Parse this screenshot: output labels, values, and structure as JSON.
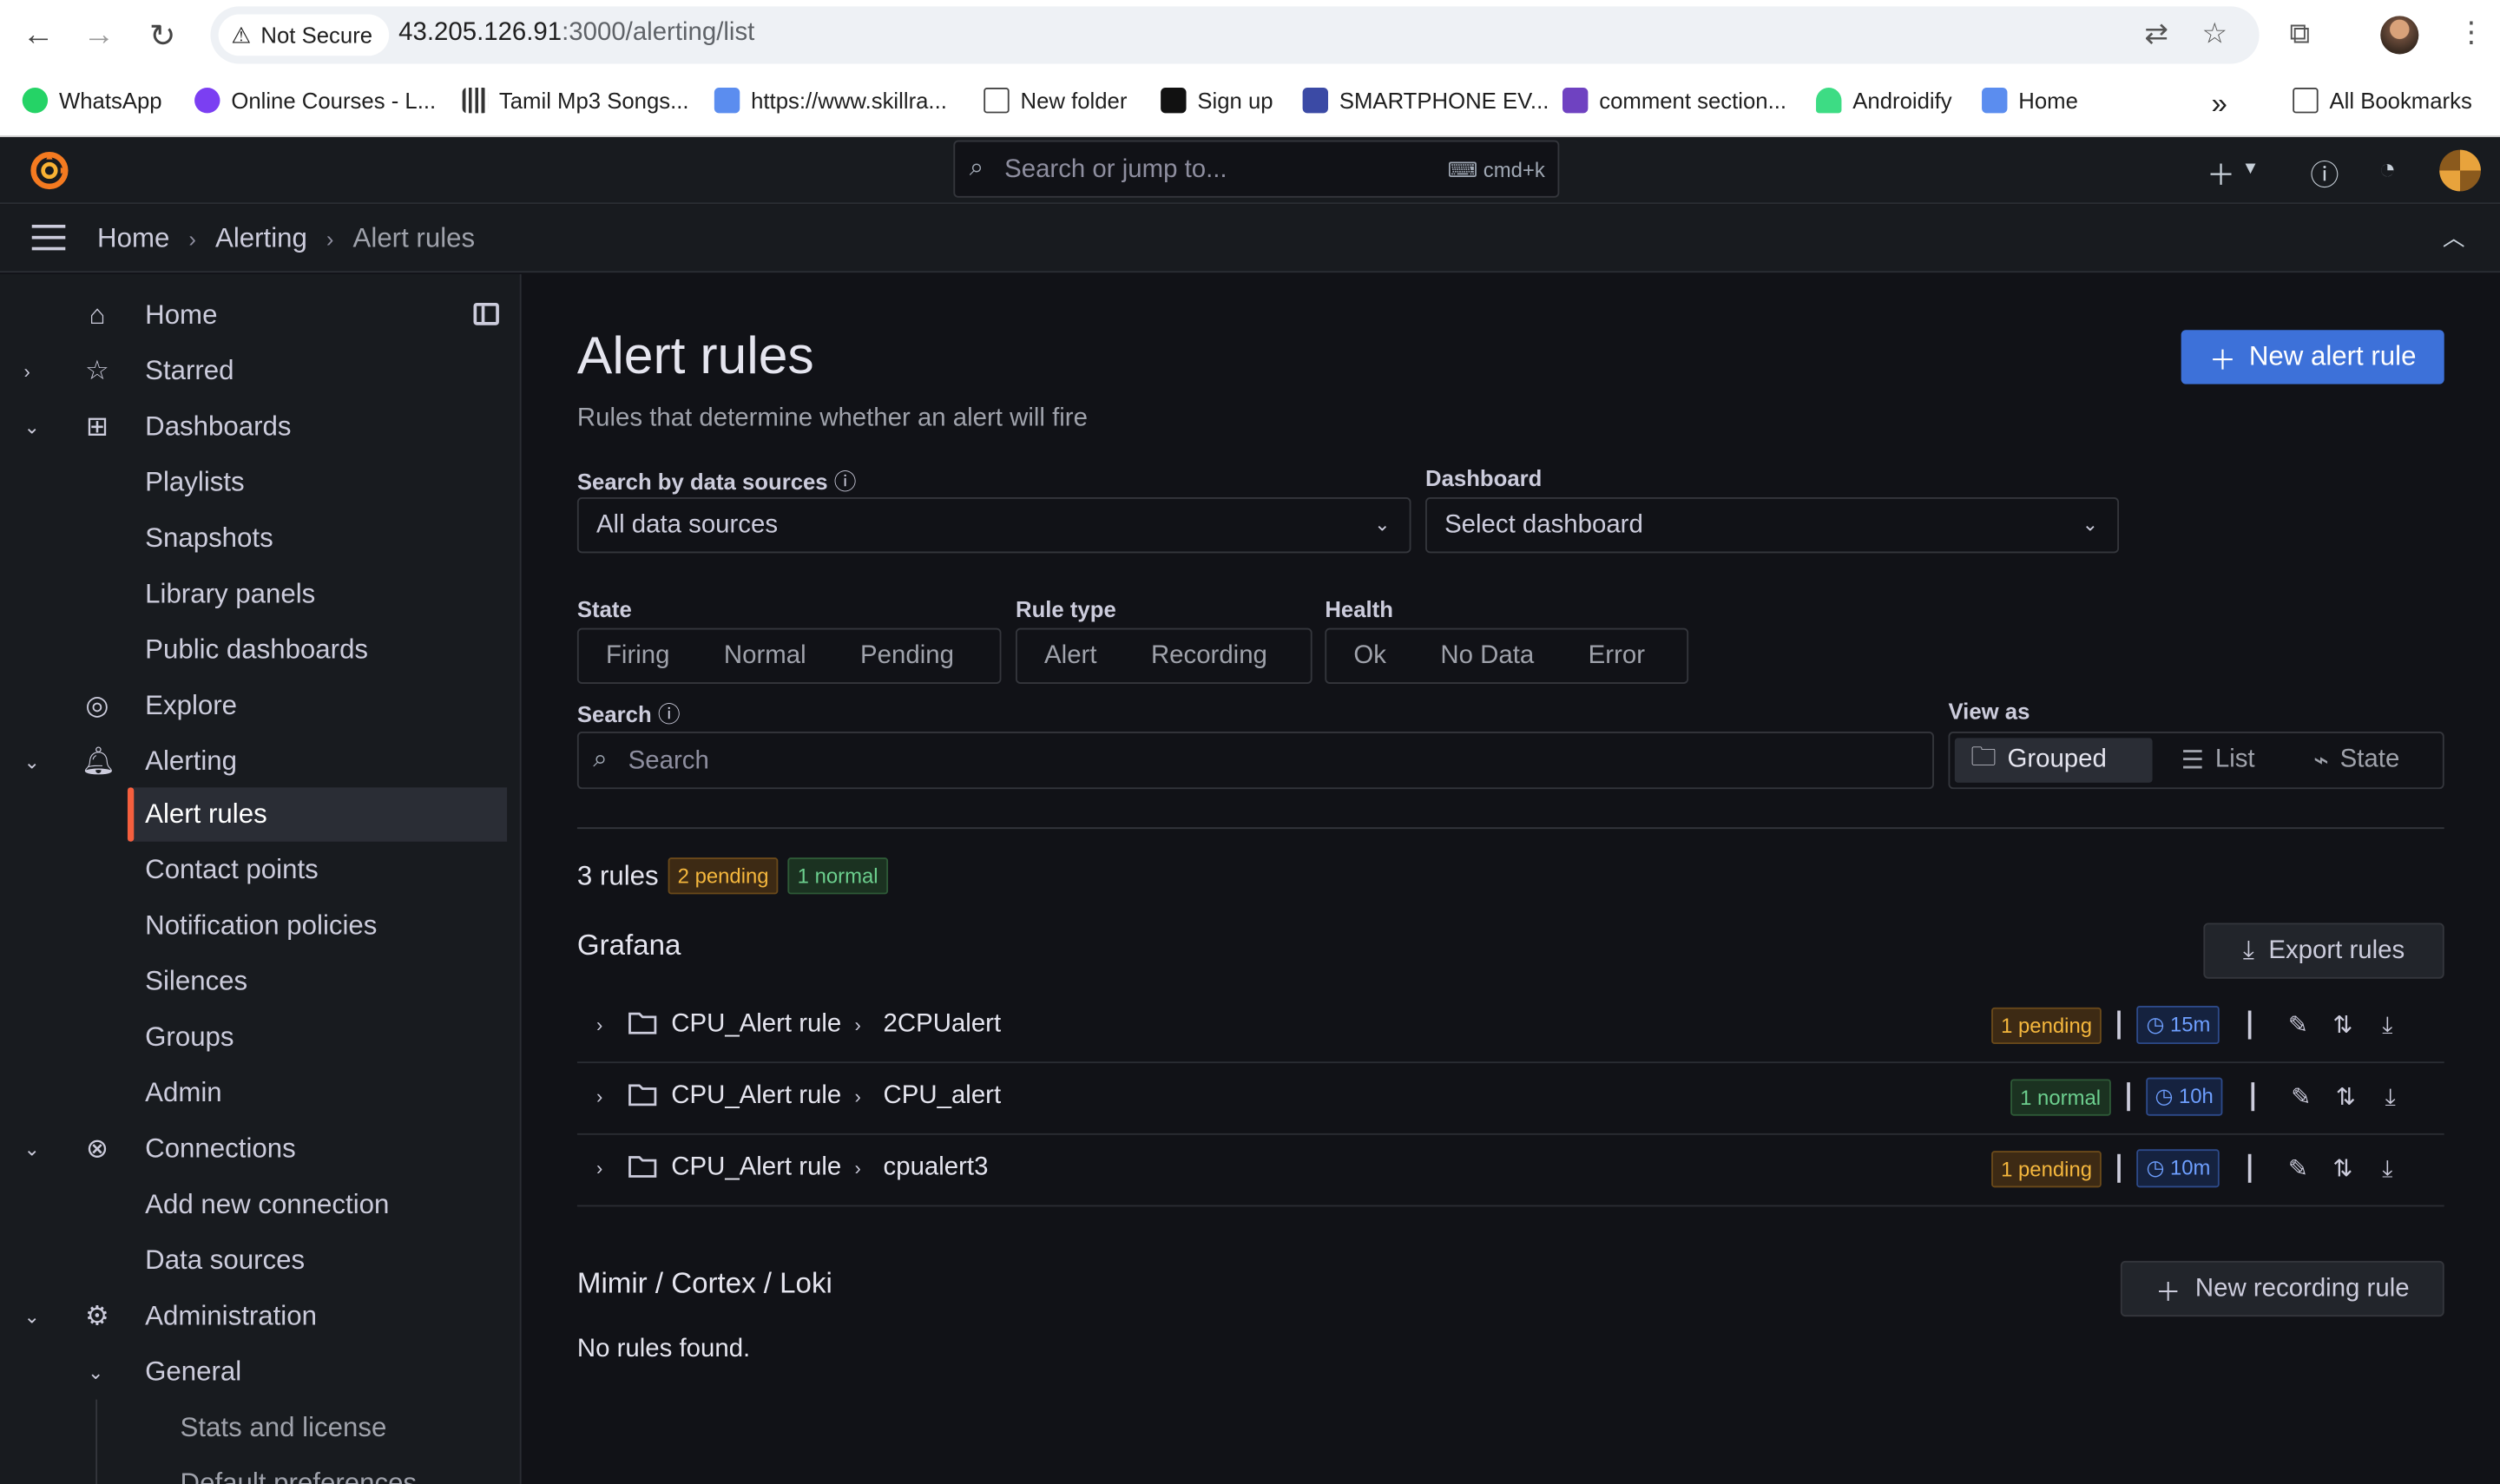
{
  "browser": {
    "secure_label": "Not Secure",
    "url_host": "43.205.126.91",
    "url_path": ":3000/alerting/list",
    "bookmarks": [
      "WhatsApp",
      "Online Courses - L...",
      "Tamil Mp3 Songs...",
      "https://www.skillra...",
      "New folder",
      "Sign up",
      "SMARTPHONE EV...",
      "comment section...",
      "Androidify",
      "Home"
    ],
    "all_bookmarks": "All Bookmarks"
  },
  "topbar": {
    "search_placeholder": "Search or jump to...",
    "shortcut": "cmd+k"
  },
  "breadcrumb": [
    "Home",
    "Alerting",
    "Alert rules"
  ],
  "sidebar": {
    "items": [
      "Home",
      "Starred",
      "Dashboards",
      "Playlists",
      "Snapshots",
      "Library panels",
      "Public dashboards",
      "Explore",
      "Alerting",
      "Alert rules",
      "Contact points",
      "Notification policies",
      "Silences",
      "Groups",
      "Admin",
      "Connections",
      "Add new connection",
      "Data sources",
      "Administration",
      "General",
      "Stats and license",
      "Default preferences"
    ]
  },
  "page": {
    "title": "Alert rules",
    "subtitle": "Rules that determine whether an alert will fire",
    "new_rule_button": "New alert rule",
    "ds_label": "Search by data sources",
    "ds_value": "All data sources",
    "dashboard_label": "Dashboard",
    "dashboard_value": "Select dashboard",
    "state_label": "State",
    "state_options": [
      "Firing",
      "Normal",
      "Pending"
    ],
    "ruletype_label": "Rule type",
    "ruletype_options": [
      "Alert",
      "Recording"
    ],
    "health_label": "Health",
    "health_options": [
      "Ok",
      "No Data",
      "Error"
    ],
    "search_label": "Search",
    "search_placeholder": "Search",
    "viewas_label": "View as",
    "view_options": [
      "Grouped",
      "List",
      "State"
    ],
    "rules_count": "3 rules",
    "pending_badge": "2 pending",
    "normal_badge": "1 normal"
  },
  "grafana_section": {
    "title": "Grafana",
    "export_button": "Export rules",
    "rows": [
      {
        "namespace": "CPU_Alert rule",
        "group": "2CPUalert",
        "state": "1 pending",
        "interval": "15m"
      },
      {
        "namespace": "CPU_Alert rule",
        "group": "CPU_alert",
        "state": "1 normal",
        "interval": "10h"
      },
      {
        "namespace": "CPU_Alert rule",
        "group": "cpualert3",
        "state": "1 pending",
        "interval": "10m"
      }
    ]
  },
  "mimir_section": {
    "title": "Mimir / Cortex / Loki",
    "new_recording_button": "New recording rule",
    "empty": "No rules found."
  },
  "colors": {
    "accent": "#3d71d9",
    "brand": "#f55f3e",
    "pending": "#f5b73d",
    "normal": "#6ccf8e"
  }
}
